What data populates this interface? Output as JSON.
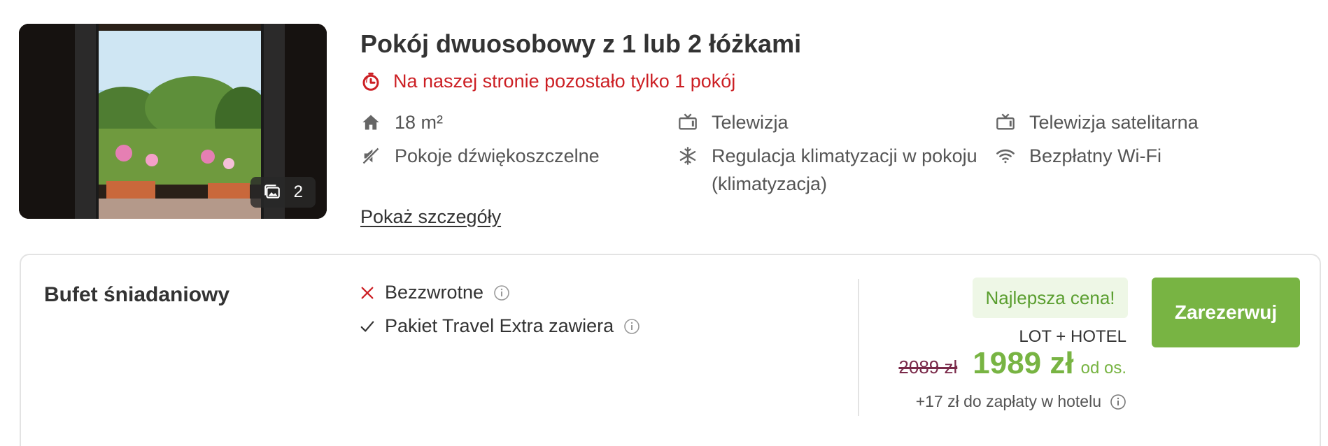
{
  "photo": {
    "count": "2",
    "icon": "gallery-icon"
  },
  "room": {
    "title": "Pokój dwuosobowy z 1 lub 2 łóżkami",
    "availability": "Na naszej stronie pozostało tylko 1 pokój",
    "availability_icon": "stopwatch-icon",
    "availability_color": "#cc1f24",
    "amenities": [
      {
        "label": "18 m²",
        "icon": "house-icon"
      },
      {
        "label": "Telewizja",
        "icon": "tv-icon"
      },
      {
        "label": "Telewizja satelitarna",
        "icon": "tv-icon"
      },
      {
        "label": "Pokoje dźwiękoszczelne",
        "icon": "soundproof-icon"
      },
      {
        "label": "Regulacja klimatyzacji w pokoju (klimatyzacja)",
        "icon": "snowflake-icon"
      },
      {
        "label": "Bezpłatny Wi-Fi",
        "icon": "wifi-icon"
      }
    ],
    "details_link": "Pokaż szczegóły"
  },
  "offer": {
    "board": "Bufet śniadaniowy",
    "conditions": [
      {
        "label": "Bezzwrotne",
        "icon": "cross-icon",
        "icon_color": "#cc1f24"
      },
      {
        "label": "Pakiet Travel Extra zawiera",
        "icon": "check-icon",
        "icon_color": "#333333"
      }
    ],
    "best_price_badge": "Najlepsza cena!",
    "package_type": "LOT + HOTEL",
    "old_price": "2089 zł",
    "new_price": "1989 zł",
    "per_person": "od os.",
    "extra_fee": "+17 zł do zapłaty w hotelu",
    "reserve_button": "Zarezerwuj",
    "accent_color": "#78b443"
  }
}
